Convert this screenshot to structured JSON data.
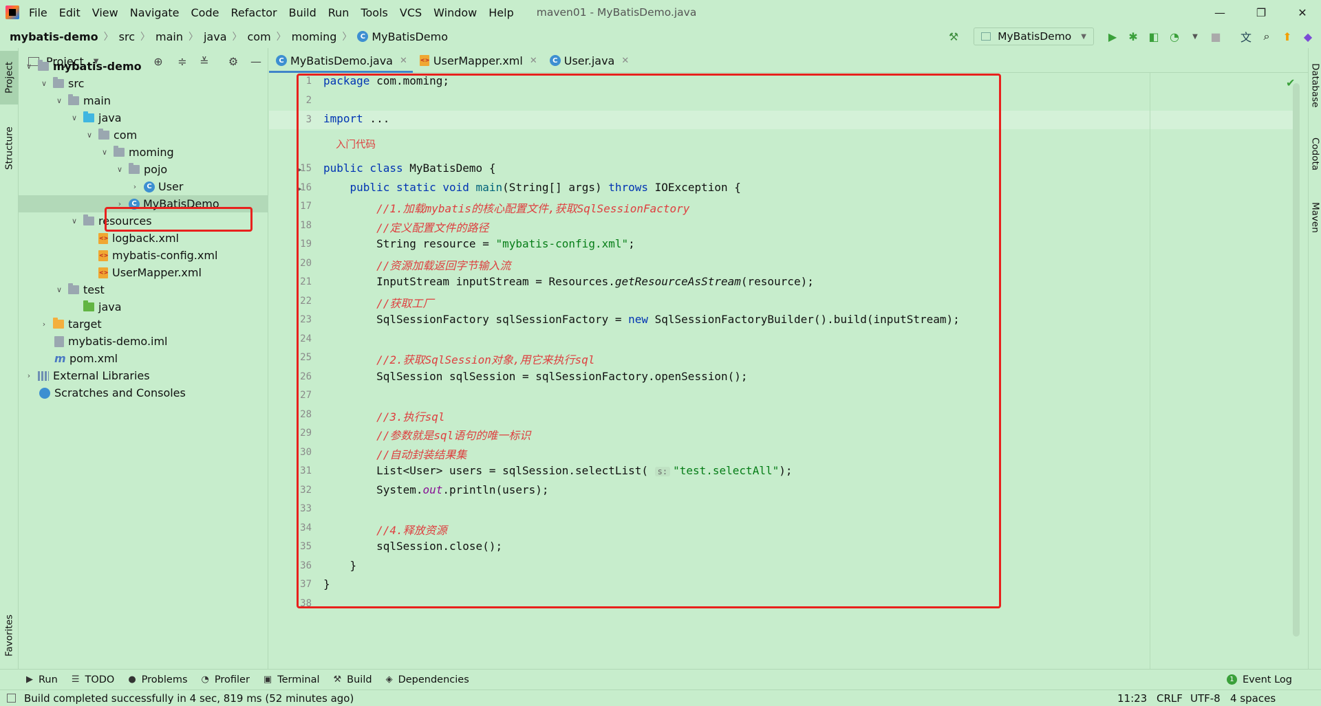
{
  "window": {
    "menu": [
      "File",
      "Edit",
      "View",
      "Navigate",
      "Code",
      "Refactor",
      "Build",
      "Run",
      "Tools",
      "VCS",
      "Window",
      "Help"
    ],
    "title": "maven01 - MyBatisDemo.java",
    "controls": {
      "minimize": "—",
      "restore": "❐",
      "close": "✕"
    }
  },
  "breadcrumb": [
    "mybatis-demo",
    "src",
    "main",
    "java",
    "com",
    "moming",
    "MyBatisDemo"
  ],
  "toolbar": {
    "run_config": "MyBatisDemo"
  },
  "left_strip": {
    "project": "Project",
    "structure": "Structure",
    "favorites": "Favorites"
  },
  "project_panel": {
    "title": "Project",
    "tree": [
      {
        "label": "mybatis-demo",
        "bold": true
      },
      {
        "label": "src"
      },
      {
        "label": "main"
      },
      {
        "label": "java"
      },
      {
        "label": "com"
      },
      {
        "label": "moming"
      },
      {
        "label": "pojo"
      },
      {
        "label": "User"
      },
      {
        "label": "MyBatisDemo"
      },
      {
        "label": "resources"
      },
      {
        "label": "logback.xml"
      },
      {
        "label": "mybatis-config.xml"
      },
      {
        "label": "UserMapper.xml"
      },
      {
        "label": "test"
      },
      {
        "label": "java"
      },
      {
        "label": "target"
      },
      {
        "label": "mybatis-demo.iml"
      },
      {
        "label": "pom.xml"
      },
      {
        "label": "External Libraries"
      },
      {
        "label": "Scratches and Consoles"
      }
    ]
  },
  "editor_tabs": [
    {
      "label": "MyBatisDemo.java",
      "active": true
    },
    {
      "label": "UserMapper.xml"
    },
    {
      "label": "User.java"
    }
  ],
  "editor": {
    "line_numbers": [
      "1",
      "2",
      "3",
      "15",
      "16",
      "17",
      "18",
      "19",
      "20",
      "21",
      "22",
      "23",
      "24",
      "25",
      "26",
      "27",
      "28",
      "29",
      "30",
      "31",
      "32",
      "33",
      "34",
      "35",
      "36",
      "37",
      "38"
    ],
    "inlay_doc": "入门代码",
    "code": {
      "l1_kw": "package",
      "l1_rest": " com.moming;",
      "l3_kw": "import",
      "l3_rest": " ...",
      "l15_kw": "public class",
      "l15_rest": " MyBatisDemo {",
      "l16_kw1": "    public static void",
      "l16_meth": " main",
      "l16_mid": "(String[] args) ",
      "l16_kw2": "throws",
      "l16_rest": " IOException {",
      "l17": "        //1.加载mybatis的核心配置文件,获取SqlSessionFactory",
      "l18": "        //定义配置文件的路径",
      "l19_a": "        String resource = ",
      "l19_str": "\"mybatis-config.xml\"",
      "l19_b": ";",
      "l20": "        //资源加载返回字节输入流",
      "l21_a": "        InputStream inputStream = Resources.",
      "l21_ital": "getResourceAsStream",
      "l21_b": "(resource);",
      "l22": "        //获取工厂",
      "l23_a": "        SqlSessionFactory sqlSessionFactory = ",
      "l23_kw": "new",
      "l23_b": " SqlSessionFactoryBuilder().build(inputStream);",
      "l25": "        //2.获取SqlSession对象,用它来执行sql",
      "l26": "        SqlSession sqlSession = sqlSessionFactory.openSession();",
      "l28": "        //3.执行sql",
      "l29": "        //参数就是sql语句的唯一标识",
      "l30": "        //自动封装结果集",
      "l31_a": "        List<User> users = sqlSession.selectList( ",
      "l31_hint": "s:",
      "l31_str": "\"test.selectAll\"",
      "l31_b": ");",
      "l32_a": "        System.",
      "l32_static": "out",
      "l32_b": ".println(users);",
      "l34": "        //4.释放资源",
      "l35": "        sqlSession.close();",
      "l36": "    }",
      "l37": "}"
    }
  },
  "right_strip": {
    "database": "Database",
    "codota": "Codota",
    "maven": "Maven"
  },
  "bottom_tools": [
    "Run",
    "TODO",
    "Problems",
    "Profiler",
    "Terminal",
    "Build",
    "Dependencies"
  ],
  "event_log": "Event Log",
  "status": {
    "message": "Build completed successfully in 4 sec, 819 ms (52 minutes ago)",
    "position": "11:23",
    "line_sep": "CRLF",
    "encoding": "UTF-8",
    "indent": "4 spaces"
  },
  "colors": {
    "background": "#c7edcc",
    "keyword": "#0033b3",
    "string": "#067d17",
    "comment": "#de3f3f",
    "highlight_box": "#e8211d"
  }
}
